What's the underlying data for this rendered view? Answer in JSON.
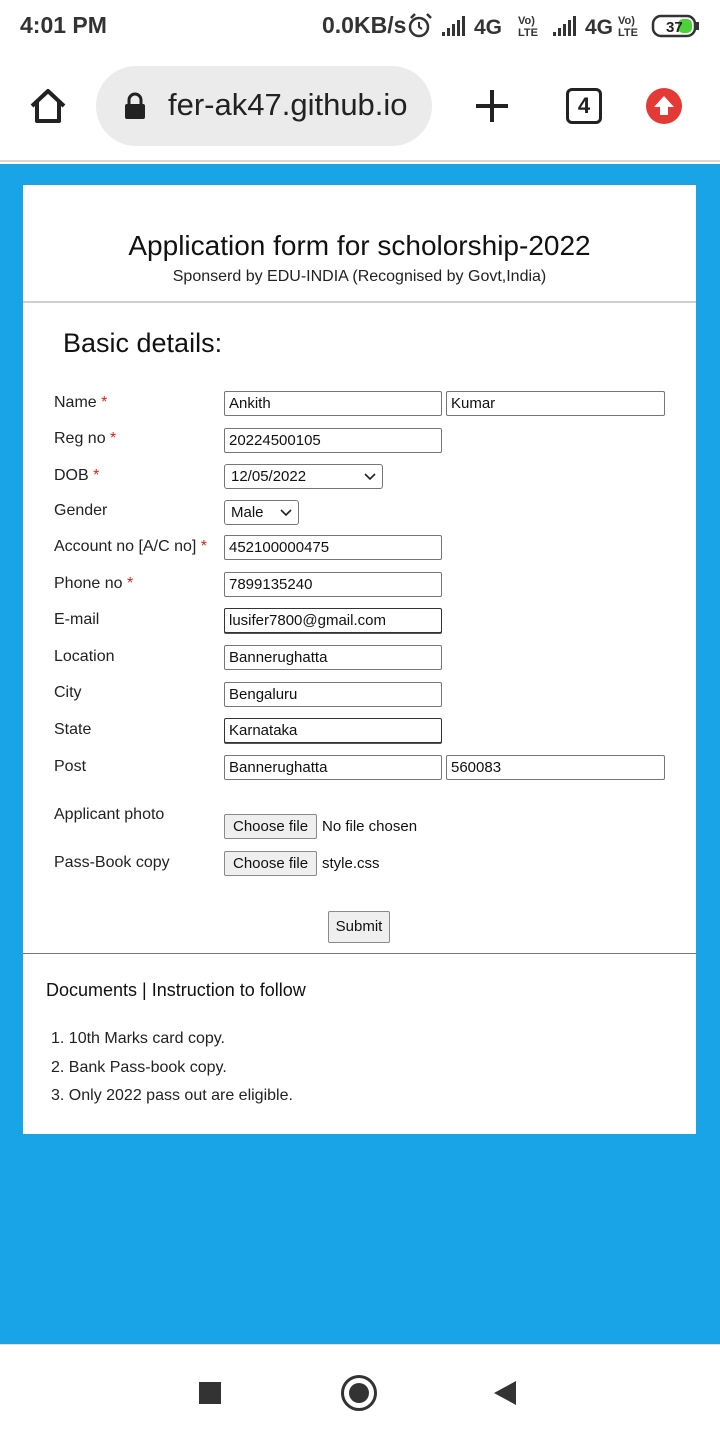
{
  "status": {
    "time": "4:01 PM",
    "speed": "0.0KB/s",
    "network1": "4G",
    "network2": "4G",
    "volte": "Vo) LTE",
    "battery": "37"
  },
  "browser": {
    "url": "fer-ak47.github.io",
    "tab_count": "4"
  },
  "header": {
    "title": "Application form for scholorship-2022",
    "subtitle": "Sponserd by EDU-INDIA (Recognised by Govt,India)"
  },
  "form": {
    "section_title": "Basic details:",
    "required_mark": "*",
    "name": {
      "label": "Name",
      "first": "Ankith",
      "last": "Kumar"
    },
    "reg": {
      "label": "Reg no",
      "value": "20224500105"
    },
    "dob": {
      "label": "DOB",
      "value": "12/05/2022"
    },
    "gender": {
      "label": "Gender",
      "value": "Male"
    },
    "account": {
      "label": "Account no [A/C no]",
      "value": "452100000475"
    },
    "phone": {
      "label": "Phone no",
      "value": "7899135240"
    },
    "email": {
      "label": "E-mail",
      "value": "lusifer7800@gmail.com"
    },
    "location": {
      "label": "Location",
      "value": "Bannerughatta"
    },
    "city": {
      "label": "City",
      "value": "Bengaluru"
    },
    "state": {
      "label": "State",
      "value": "Karnataka"
    },
    "post": {
      "label": "Post",
      "value": "Bannerughatta",
      "pin": "560083"
    },
    "photo": {
      "label": "Applicant photo",
      "button": "Choose file",
      "file": "No file chosen"
    },
    "passbook": {
      "label": "Pass-Book copy",
      "button": "Choose file",
      "file": "style.css"
    },
    "submit": "Submit"
  },
  "instructions": {
    "title": "Documents | Instruction to follow",
    "items": [
      "1.  10th Marks card copy.",
      "2.  Bank Pass-book copy.",
      "3.  Only 2022 pass out are eligible."
    ]
  },
  "colors": {
    "page_background": "#18a4e6",
    "required": "#e0201a",
    "upload_button": "#e53935"
  }
}
